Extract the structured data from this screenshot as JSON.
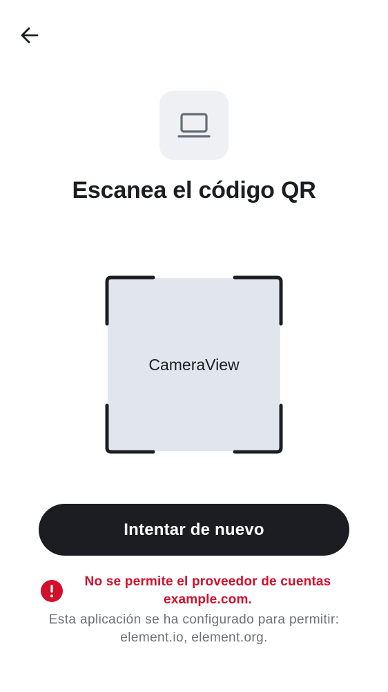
{
  "header": {
    "back_icon": "arrow-left-icon"
  },
  "device_tile": {
    "icon": "laptop-icon"
  },
  "title": "Escanea el código QR",
  "scanner": {
    "camera_label": "CameraView"
  },
  "retry_button": {
    "label": "Intentar de nuevo"
  },
  "error": {
    "icon": "error-icon",
    "title_line1": "No se permite el proveedor de cuentas",
    "title_line2": "example.com.",
    "detail_line1": "Esta aplicación se ha configurado para permitir:",
    "detail_line2": "element.io, element.org."
  },
  "colors": {
    "error": "#d1102b",
    "button_bg": "#1b1d22",
    "camera_bg": "#e1e5ec",
    "tile_bg": "#eef0f3"
  }
}
